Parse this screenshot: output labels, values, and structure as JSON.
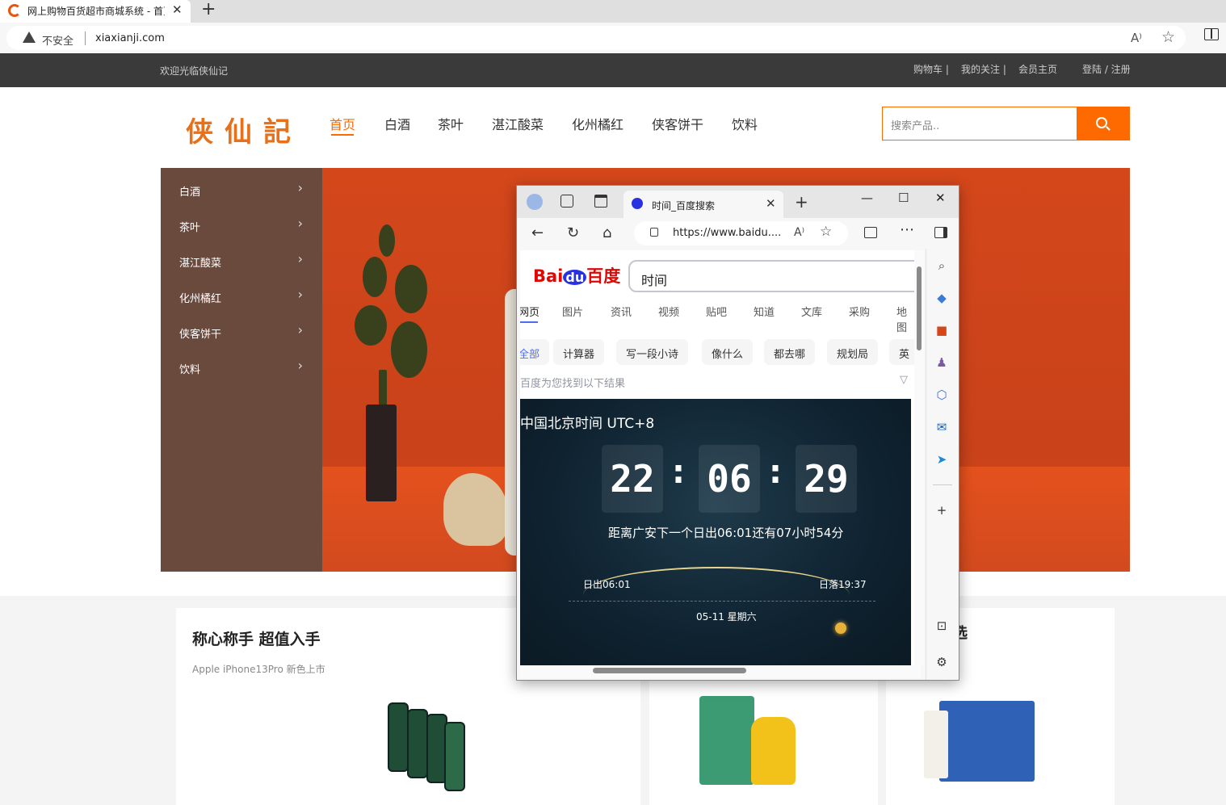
{
  "browser": {
    "tab_title": "网上购物百货超市商城系统 - 首页",
    "new_tab": "+",
    "close": "✕",
    "security": "不安全",
    "url": "xiaxianji.com",
    "read_aloud": "A⁾",
    "favorite": "☆"
  },
  "topbar": {
    "welcome": "欢迎光临侠仙记",
    "links": [
      "购物车 |",
      "我的关注 |",
      "会员主页",
      "登陆 / 注册"
    ]
  },
  "header": {
    "logo": "侠仙記",
    "nav": [
      "首页",
      "白酒",
      "茶叶",
      "湛江酸菜",
      "化州橘红",
      "侠客饼干",
      "饮料"
    ],
    "search_placeholder": "搜索产品.."
  },
  "categories": [
    "白酒",
    "茶叶",
    "湛江酸菜",
    "化州橘红",
    "侠客饼干",
    "饮料"
  ],
  "promo": {
    "title": "称心称手 超值入手",
    "subtitle": "Apple iPhone13Pro 新色上市",
    "third_card_partial": "选"
  },
  "edge": {
    "tab_title": "时间_百度搜索",
    "url": "https://www.baidu....",
    "window_controls": [
      "—",
      "☐",
      "✕"
    ]
  },
  "baidu": {
    "logo_a": "Bai",
    "logo_b": "du",
    "logo_c": "百度",
    "query": "时间",
    "tabs": [
      "网页",
      "图片",
      "资讯",
      "视频",
      "贴吧",
      "知道",
      "文库",
      "采购",
      "地图"
    ],
    "chips": [
      "全部",
      "计算器",
      "写一段小诗",
      "像什么",
      "都去哪",
      "规划局",
      "英"
    ],
    "found": "百度为您找到以下结果",
    "clock_title": "中国北京时间 UTC+8",
    "hours": "22",
    "minutes": "06",
    "seconds": "29",
    "sunrise_text": "距离广安下一个日出06:01还有07小时54分",
    "rise_label": "日出06:01",
    "set_label": "日落19:37",
    "date_label": "05-11  星期六"
  },
  "colors": {
    "accent": "#ff6a00",
    "topbar": "#3a3a3a",
    "banner": "#d4471b",
    "category_bg": "#6b4a3e",
    "baidu_blue": "#2932e1",
    "baidu_red": "#e10602"
  }
}
